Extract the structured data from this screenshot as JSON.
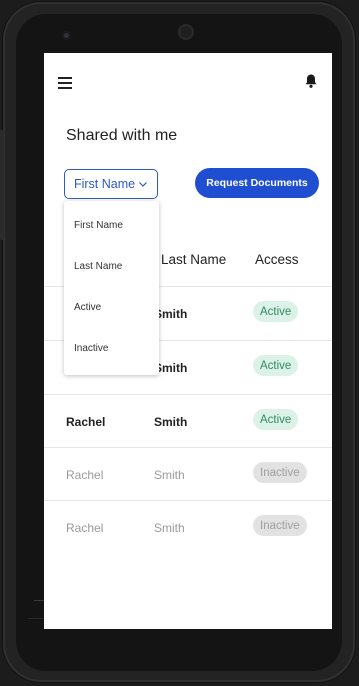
{
  "header": {
    "menu_icon": "hamburger-menu-icon",
    "bell_icon": "bell-icon"
  },
  "page": {
    "title": "Shared with me"
  },
  "filter": {
    "selected": "First Name",
    "chevron_icon": "chevron-down-icon",
    "options": [
      "First Name",
      "Last Name",
      "Active",
      "Inactive"
    ]
  },
  "actions": {
    "request_documents": "Request Documents"
  },
  "table": {
    "columns": [
      "Last Name",
      "Access"
    ],
    "rows": [
      {
        "first_name": "",
        "last_name": "Smith",
        "access": "Active",
        "status": "active"
      },
      {
        "first_name": "",
        "last_name": "Smith",
        "access": "Active",
        "status": "active"
      },
      {
        "first_name": "Rachel",
        "last_name": "Smith",
        "access": "Active",
        "status": "active"
      },
      {
        "first_name": "Rachel",
        "last_name": "Smith",
        "access": "Inactive",
        "status": "inactive"
      },
      {
        "first_name": "Rachel",
        "last_name": "Smith",
        "access": "Inactive",
        "status": "inactive"
      }
    ]
  },
  "colors": {
    "primary": "#1f4fd0",
    "active_badge_bg": "#dcf2e8",
    "active_badge_text": "#2f8a61",
    "inactive_badge_bg": "#e2e2e2"
  }
}
